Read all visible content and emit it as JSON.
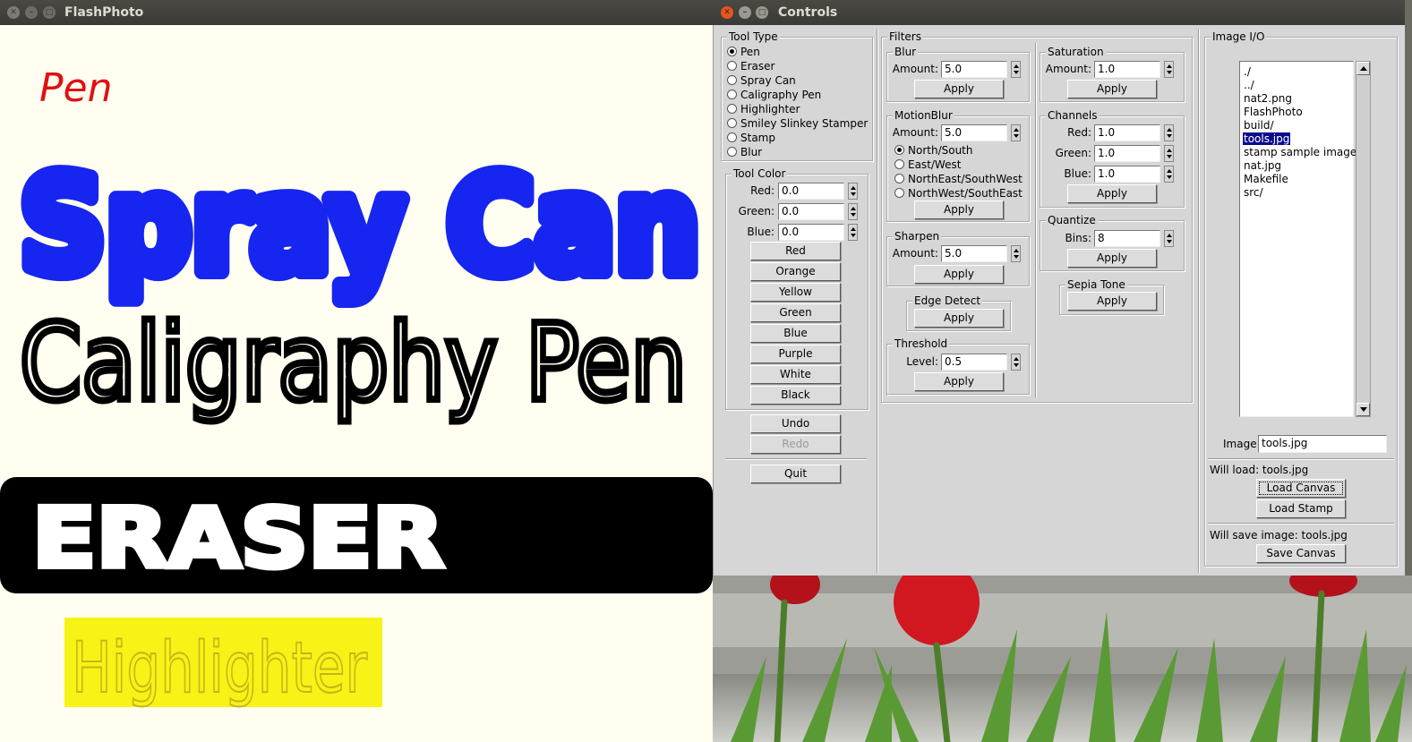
{
  "flashphoto": {
    "title": "FlashPhoto",
    "canvas": {
      "pen_text": "Pen",
      "spray_text": "Spray Can",
      "caligraphy_text": "Caligraphy Pen",
      "eraser_text": "ERASER",
      "highlighter_text": "Highlighter"
    }
  },
  "controls": {
    "title": "Controls",
    "tool_type": {
      "legend": "Tool Type",
      "options": [
        "Pen",
        "Eraser",
        "Spray Can",
        "Caligraphy Pen",
        "Highlighter",
        "Smiley Slinkey Stamper",
        "Stamp",
        "Blur"
      ],
      "selected": "Pen"
    },
    "tool_color": {
      "legend": "Tool Color",
      "red_label": "Red:",
      "red_value": "0.0",
      "green_label": "Green:",
      "green_value": "0.0",
      "blue_label": "Blue:",
      "blue_value": "0.0",
      "swatches": [
        "Red",
        "Orange",
        "Yellow",
        "Green",
        "Blue",
        "Purple",
        "White",
        "Black"
      ]
    },
    "undo_label": "Undo",
    "redo_label": "Redo",
    "quit_label": "Quit",
    "filters": {
      "legend": "Filters",
      "blur": {
        "legend": "Blur",
        "amount_label": "Amount:",
        "amount": "5.0",
        "apply": "Apply"
      },
      "motion_blur": {
        "legend": "MotionBlur",
        "amount_label": "Amount:",
        "amount": "5.0",
        "directions": [
          "North/South",
          "East/West",
          "NorthEast/SouthWest",
          "NorthWest/SouthEast"
        ],
        "selected": "North/South",
        "apply": "Apply"
      },
      "sharpen": {
        "legend": "Sharpen",
        "amount_label": "Amount:",
        "amount": "5.0",
        "apply": "Apply"
      },
      "edge_detect": {
        "legend": "Edge Detect",
        "apply": "Apply"
      },
      "threshold": {
        "legend": "Threshold",
        "level_label": "Level:",
        "level": "0.5",
        "apply": "Apply"
      },
      "saturation": {
        "legend": "Saturation",
        "amount_label": "Amount:",
        "amount": "1.0",
        "apply": "Apply"
      },
      "channels": {
        "legend": "Channels",
        "red_label": "Red:",
        "red": "1.0",
        "green_label": "Green:",
        "green": "1.0",
        "blue_label": "Blue:",
        "blue": "1.0",
        "apply": "Apply"
      },
      "quantize": {
        "legend": "Quantize",
        "bins_label": "Bins:",
        "bins": "8",
        "apply": "Apply"
      },
      "sepia": {
        "legend": "Sepia Tone",
        "apply": "Apply"
      }
    },
    "image_io": {
      "legend": "Image I/O",
      "files": [
        "./",
        "../",
        "nat2.png",
        "FlashPhoto",
        "build/",
        "tools.jpg",
        "stamp sample image.",
        "nat.jpg",
        "Makefile",
        "src/"
      ],
      "selected_file": "tools.jpg",
      "image_label": "Image:",
      "image_value": "tools.jpg",
      "will_load": "Will load: tools.jpg",
      "load_canvas": "Load Canvas",
      "load_stamp": "Load Stamp",
      "will_save": "Will save image: tools.jpg",
      "save_canvas": "Save Canvas"
    }
  },
  "colors": {
    "canvas_bg": "#fffef0",
    "pen_red": "#e01010",
    "spray_blue": "#0a1af0",
    "highlighter_yellow": "#f7f20a",
    "eraser_black": "#000000",
    "selection_blue": "#0b0b8c"
  }
}
